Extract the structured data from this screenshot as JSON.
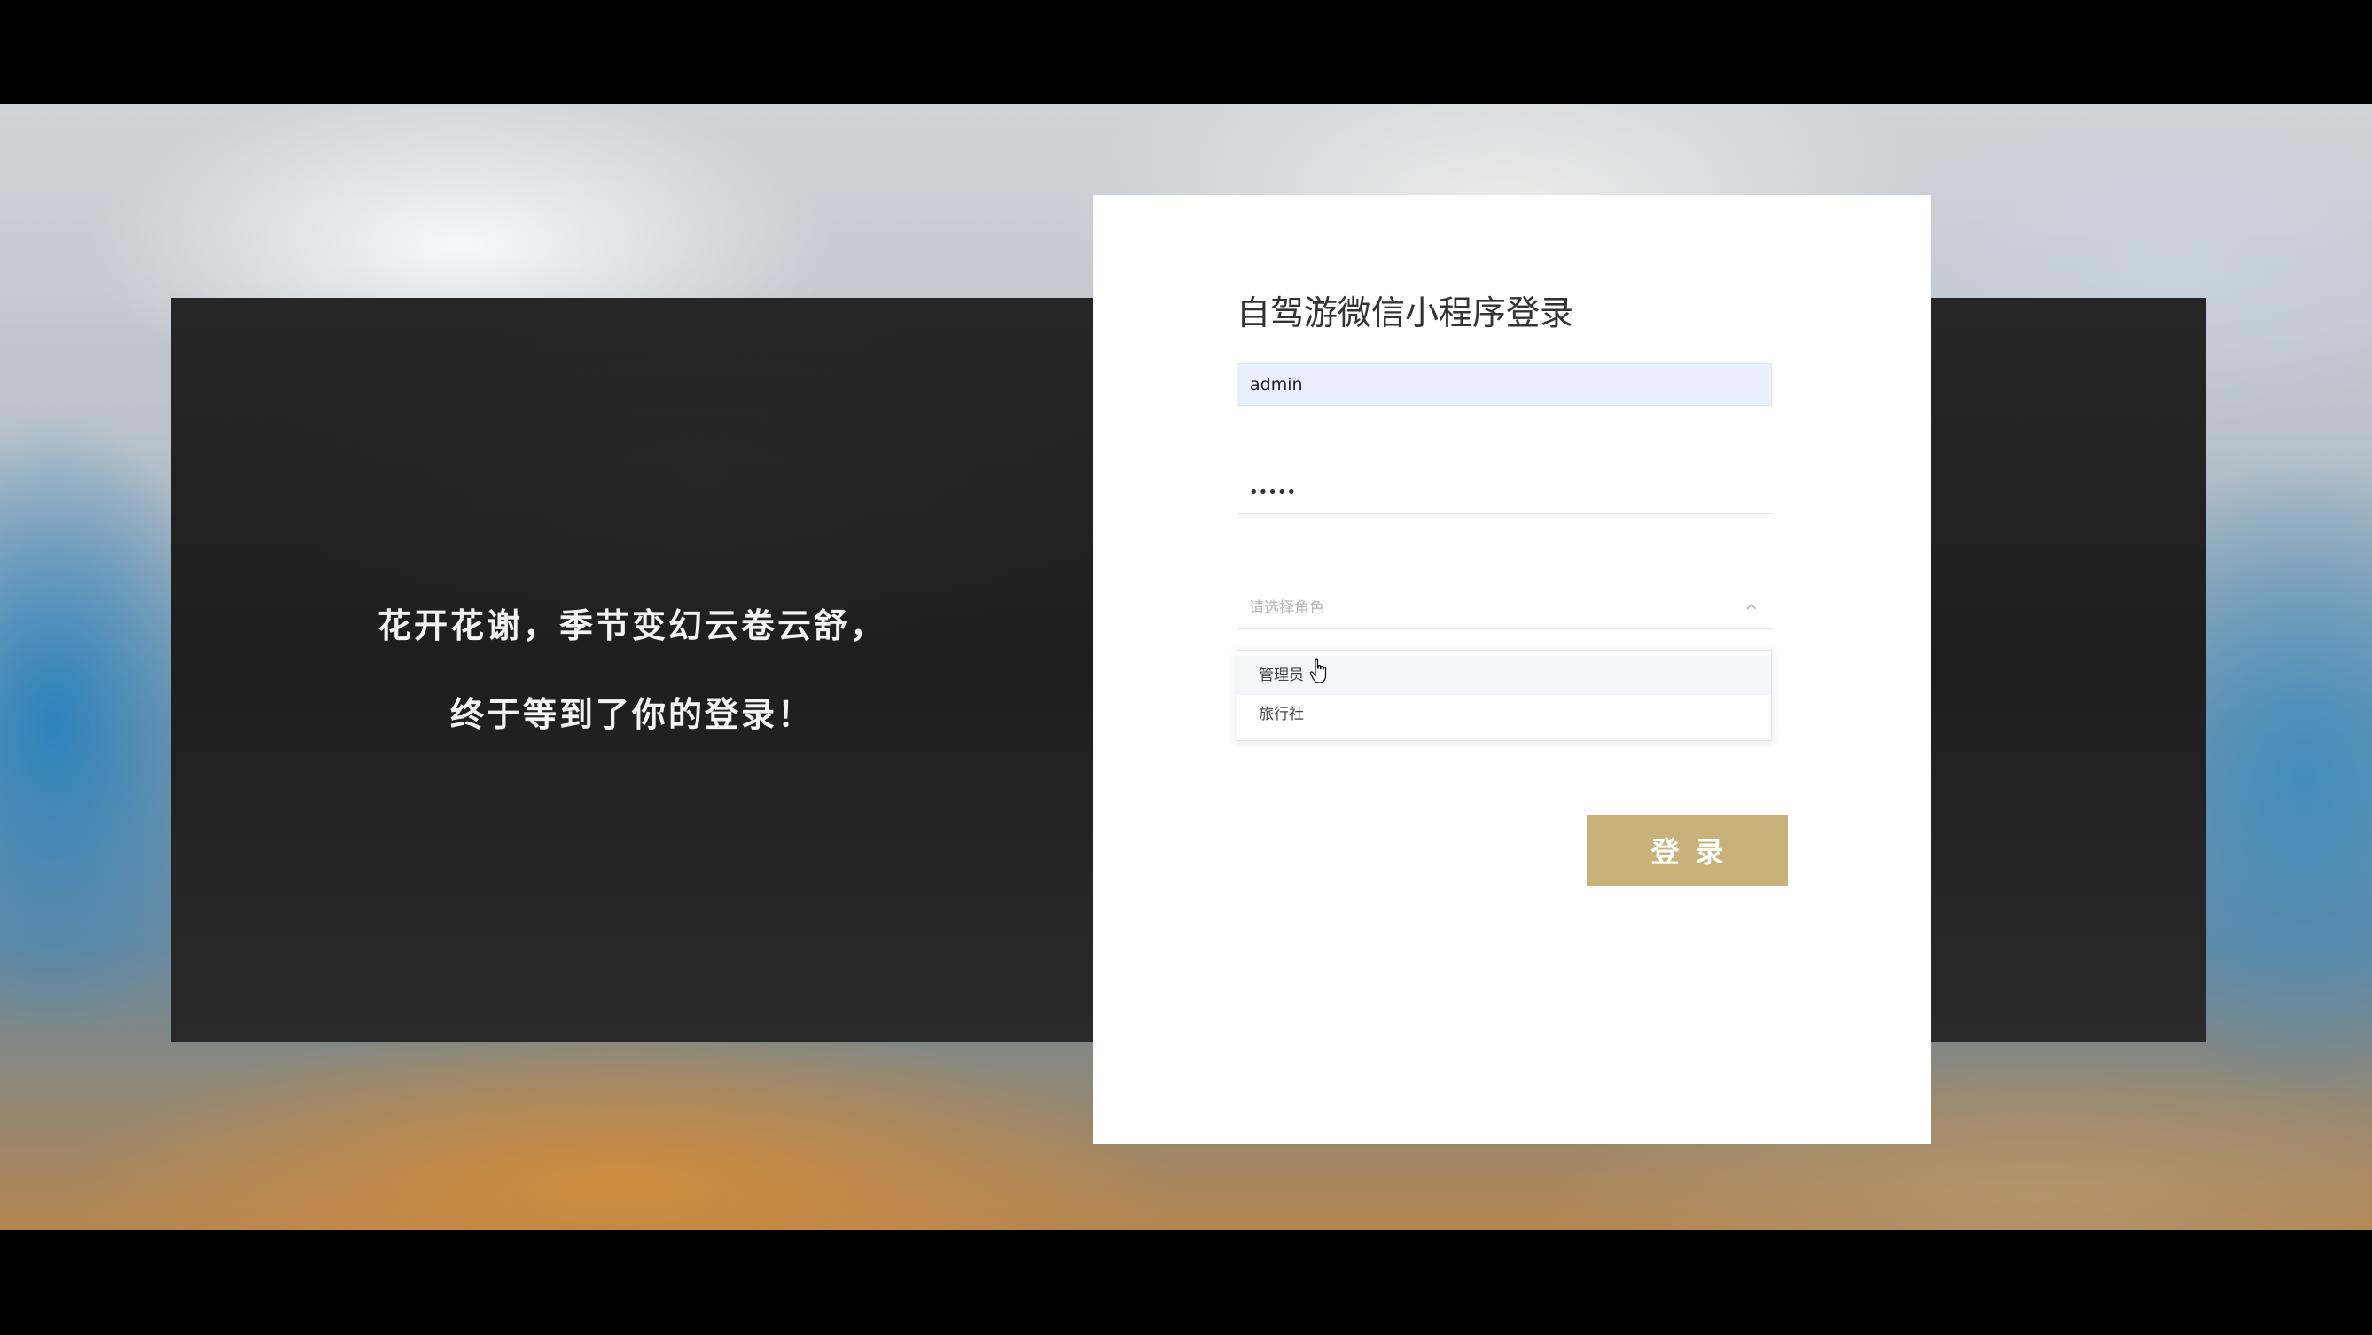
{
  "slogan": {
    "line1": "花开花谢，季节变幻云卷云舒，",
    "line2": "终于等到了你的登录！"
  },
  "login": {
    "title": "自驾游微信小程序登录",
    "username_value": "admin",
    "password_value": "•••••",
    "role_placeholder": "请选择角色",
    "role_options": [
      "管理员",
      "旅行社"
    ],
    "submit_label": "登录"
  },
  "colors": {
    "button_bg": "#c9b27a",
    "input_autofill_bg": "#e8f0fe",
    "panel_bg": "#1e1e1e"
  }
}
